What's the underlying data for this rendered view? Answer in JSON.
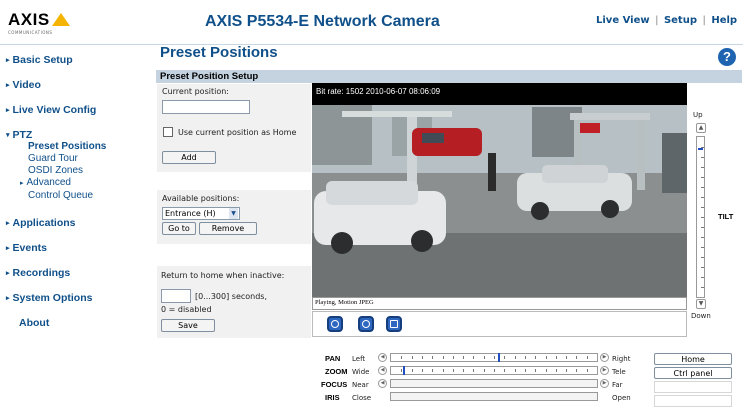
{
  "header": {
    "logo_text": "AXIS",
    "logo_sub": "COMMUNICATIONS",
    "product_title": "AXIS P5534-E Network Camera",
    "links": {
      "live_view": "Live View",
      "separator": "|",
      "setup": "Setup",
      "help": "Help"
    }
  },
  "sidebar": {
    "items": [
      {
        "label": "Basic Setup"
      },
      {
        "label": "Video"
      },
      {
        "label": "Live View Config"
      },
      {
        "label": "PTZ"
      },
      {
        "label": "Applications"
      },
      {
        "label": "Events"
      },
      {
        "label": "Recordings"
      },
      {
        "label": "System Options"
      },
      {
        "label": "About"
      }
    ],
    "ptz_sub": [
      {
        "label": "Preset Positions"
      },
      {
        "label": "Guard Tour"
      },
      {
        "label": "OSDI Zones"
      },
      {
        "label": "Advanced"
      },
      {
        "label": "Control Queue"
      }
    ]
  },
  "main": {
    "page_title": "Preset Positions",
    "help_glyph": "?",
    "section_title": "Preset Position Setup",
    "current_position": {
      "label": "Current position:",
      "value": "",
      "checkbox_label": "Use current position as Home",
      "add_button": "Add"
    },
    "available": {
      "label": "Available positions:",
      "selected": "Entrance (H)",
      "go_button": "Go to",
      "remove_button": "Remove"
    },
    "return_home": {
      "label": "Return to home when inactive:",
      "value": "",
      "range_text": "[0...300] seconds,",
      "disabled_text": "0 = disabled",
      "save_button": "Save"
    }
  },
  "video": {
    "overlay": "Bit rate:  1502 2010-06-07 08:06:09",
    "status": "Playing, Motion JPEG"
  },
  "tilt": {
    "up": "Up",
    "down": "Down",
    "label": "TILT",
    "level": 0.07
  },
  "ptz": {
    "pan": {
      "label": "PAN",
      "left": "Left",
      "right": "Right",
      "position": 0.52
    },
    "zoom": {
      "label": "ZOOM",
      "left": "Wide",
      "right": "Tele",
      "position": 0.06
    },
    "focus": {
      "label": "FOCUS",
      "left": "Near",
      "right": "Far"
    },
    "iris": {
      "label": "IRIS",
      "left": "Close",
      "right": "Open"
    },
    "home_button": "Home",
    "ctrl_panel_button": "Ctrl panel"
  },
  "colors": {
    "brand_blue": "#10508a",
    "section_bar": "#c5d3e0",
    "logo_yellow": "#f4b400"
  }
}
